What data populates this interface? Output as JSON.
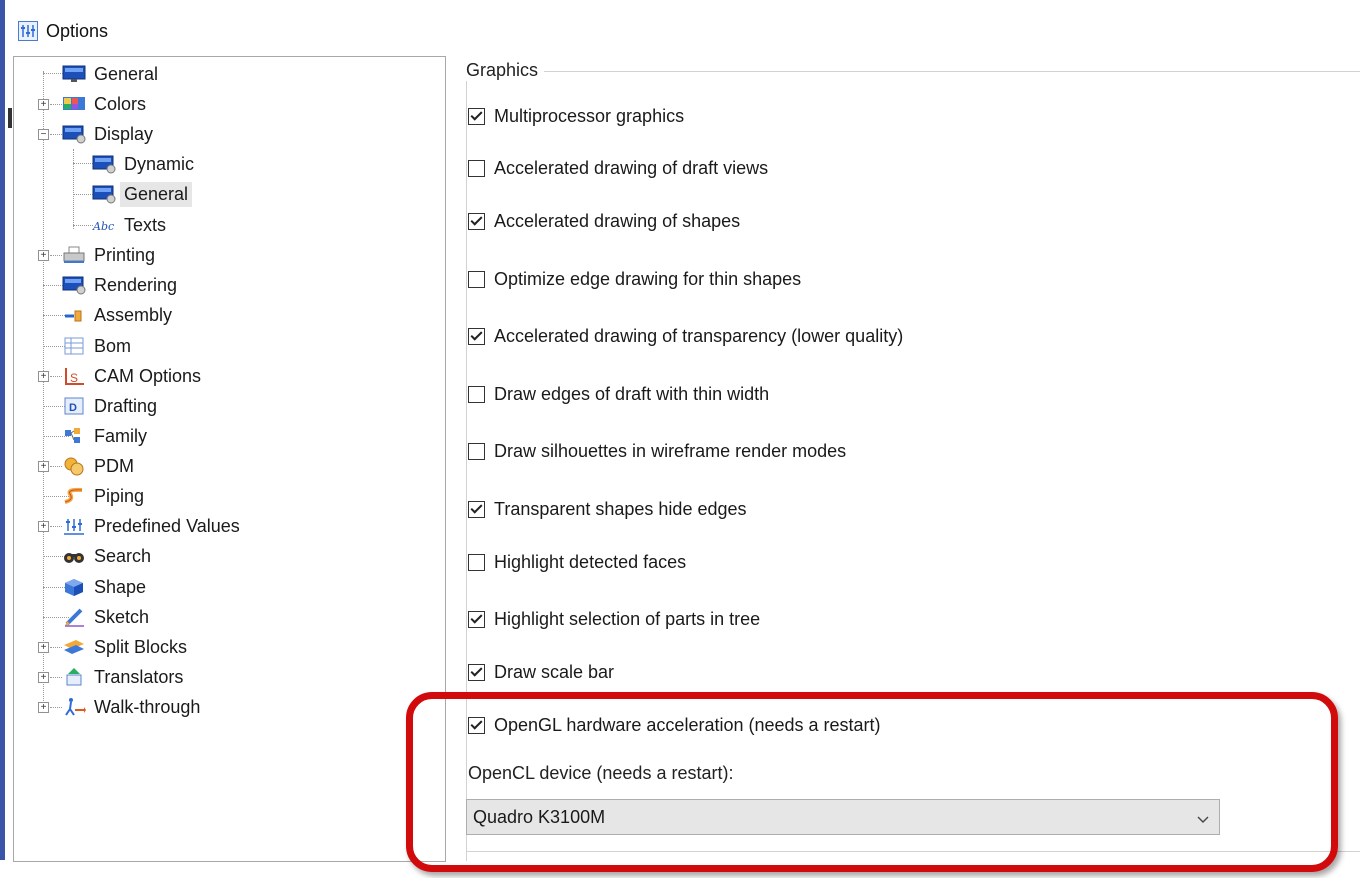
{
  "window": {
    "title": "Options",
    "title_icon": "options-sliders-icon"
  },
  "tree": {
    "items": [
      {
        "label": "General",
        "icon": "monitor-icon"
      },
      {
        "label": "Colors",
        "icon": "colors-palette-icon"
      },
      {
        "label": "Display",
        "icon": "display-monitor-icon"
      },
      {
        "label": "Dynamic",
        "icon": "display-dynamic-icon"
      },
      {
        "label": "General",
        "icon": "display-general-icon",
        "selected": true
      },
      {
        "label": "Texts",
        "icon": "abc-text-icon"
      },
      {
        "label": "Printing",
        "icon": "printer-icon"
      },
      {
        "label": "Rendering",
        "icon": "rendering-icon"
      },
      {
        "label": "Assembly",
        "icon": "assembly-icon"
      },
      {
        "label": "Bom",
        "icon": "bom-table-icon"
      },
      {
        "label": "CAM Options",
        "icon": "cam-icon"
      },
      {
        "label": "Drafting",
        "icon": "drafting-icon"
      },
      {
        "label": "Family",
        "icon": "family-icon"
      },
      {
        "label": "PDM",
        "icon": "pdm-icon"
      },
      {
        "label": "Piping",
        "icon": "piping-icon"
      },
      {
        "label": "Predefined Values",
        "icon": "predefined-values-icon"
      },
      {
        "label": "Search",
        "icon": "search-binoculars-icon"
      },
      {
        "label": "Shape",
        "icon": "shape-cube-icon"
      },
      {
        "label": "Sketch",
        "icon": "sketch-pencil-icon"
      },
      {
        "label": "Split Blocks",
        "icon": "split-blocks-icon"
      },
      {
        "label": "Translators",
        "icon": "translators-icon"
      },
      {
        "label": "Walk-through",
        "icon": "walk-through-icon"
      }
    ]
  },
  "graphics": {
    "group_label": "Graphics",
    "options": [
      {
        "label": "Multiprocessor graphics",
        "checked": true
      },
      {
        "label": "Accelerated drawing of draft views",
        "checked": false
      },
      {
        "label": "Accelerated drawing of shapes",
        "checked": true
      },
      {
        "label": "Optimize edge drawing for thin shapes",
        "checked": false
      },
      {
        "label": "Accelerated drawing of transparency (lower quality)",
        "checked": true
      },
      {
        "label": "Draw edges of draft with thin width",
        "checked": false
      },
      {
        "label": "Draw silhouettes in wireframe render modes",
        "checked": false
      },
      {
        "label": "Transparent shapes hide edges",
        "checked": true
      },
      {
        "label": "Highlight detected faces",
        "checked": false
      },
      {
        "label": "Highlight selection of parts in tree",
        "checked": true
      },
      {
        "label": "Draw scale bar",
        "checked": true
      },
      {
        "label": "OpenGL hardware acceleration (needs a restart)",
        "checked": true
      }
    ],
    "opencl_label": "OpenCL device (needs a restart):",
    "opencl_device": "Quadro K3100M"
  },
  "colors": {
    "accent": "#3a55a8",
    "highlight_border": "#d10b0b",
    "selection_bg": "#e6e6e6"
  }
}
